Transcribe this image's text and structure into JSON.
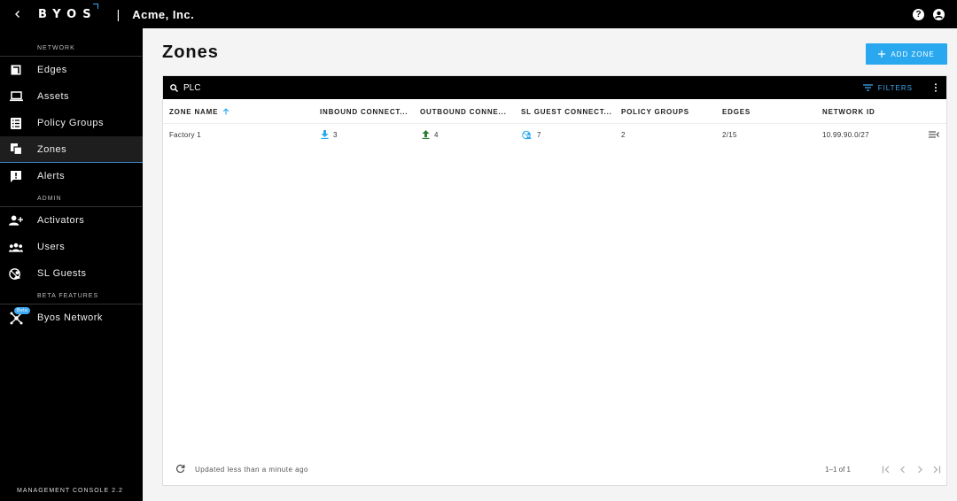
{
  "header": {
    "logo_text": "BYOS",
    "separator": "|",
    "org_name": "Acme, Inc.",
    "help_glyph": "?",
    "icons": [
      "back-chevron-icon",
      "help-icon",
      "account-icon"
    ]
  },
  "sidebar": {
    "section_network": "NETWORK",
    "items_network": [
      {
        "label": "Edges",
        "icon": "edges-icon"
      },
      {
        "label": "Assets",
        "icon": "laptop-icon"
      },
      {
        "label": "Policy Groups",
        "icon": "policy-groups-icon"
      },
      {
        "label": "Zones",
        "icon": "zones-icon",
        "active": true
      },
      {
        "label": "Alerts",
        "icon": "alert-icon"
      }
    ],
    "section_admin": "ADMIN",
    "items_admin": [
      {
        "label": "Activators",
        "icon": "add-user-icon"
      },
      {
        "label": "Users",
        "icon": "users-icon"
      },
      {
        "label": "SL Guests",
        "icon": "sl-guests-icon"
      }
    ],
    "section_beta": "BETA FEATURES",
    "items_beta": [
      {
        "label": "Byos Network",
        "icon": "network-icon",
        "badge": "Beta"
      }
    ],
    "version": "MANAGEMENT CONSOLE 2.2"
  },
  "main": {
    "title": "Zones",
    "add_button": "ADD ZONE",
    "search_value": "PLC",
    "filters_label": "FILTERS",
    "columns": [
      "ZONE NAME",
      "INBOUND CONNECT...",
      "OUTBOUND CONNE...",
      "SL GUEST CONNECT...",
      "POLICY GROUPS",
      "EDGES",
      "NETWORK ID"
    ],
    "sort_column": "ZONE NAME",
    "rows": [
      {
        "zone_name": "Factory 1",
        "inbound": "3",
        "outbound": "4",
        "sl_guest": "7",
        "policy_groups": "2",
        "edges": "2/15",
        "network_id": "10.99.90.0/27"
      }
    ],
    "footer": {
      "updated": "Updated less than a minute ago",
      "page_info": "1–1 of 1"
    },
    "accent_color": "#29a8f0",
    "active_border_color": "#3f82c6",
    "outbound_color": "#2e7d32"
  }
}
